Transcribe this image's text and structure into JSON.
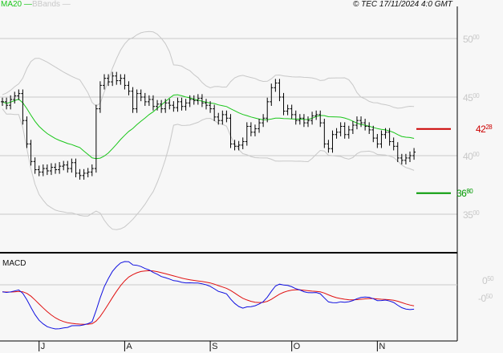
{
  "legend": {
    "ma_label": "MA20",
    "bb_label": "BBands",
    "copyright": "© TEC 17/11/2024 4:0 GMT"
  },
  "colors": {
    "ma": "#19c619",
    "bands": "#c8c8c8",
    "macd": "#1010e0",
    "signal": "#e01010",
    "resistance": "#cc0000",
    "support": "#009900"
  },
  "chart_data": {
    "type": "line",
    "title": "",
    "price_axis": {
      "ticks": [
        {
          "int": "50",
          "dec": "00",
          "value": 50
        },
        {
          "int": "45",
          "dec": "00",
          "value": 45
        },
        {
          "int": "40",
          "dec": "00",
          "value": 40
        },
        {
          "int": "35",
          "dec": "00",
          "value": 35
        }
      ],
      "ylim": [
        32.5,
        53.3
      ]
    },
    "levels": {
      "resistance": {
        "label_int": "42",
        "label_dec": "28",
        "value": 42.28
      },
      "support": {
        "label_int": "36",
        "label_dec": "80",
        "value": 36.8
      }
    },
    "macd_axis": {
      "title": "MACD",
      "ticks": [
        {
          "int": "0",
          "dec": "50",
          "value": 0.5
        },
        {
          "int": "-0",
          "dec": "50",
          "value": -0.5
        }
      ]
    },
    "months": [
      {
        "label": "J",
        "index": 9
      },
      {
        "label": "A",
        "index": 30
      },
      {
        "label": "S",
        "index": 51
      },
      {
        "label": "O",
        "index": 71
      },
      {
        "label": "N",
        "index": 92
      }
    ],
    "closes": [
      44.6,
      44.3,
      44.8,
      45.1,
      45.3,
      43.0,
      41.0,
      39.5,
      38.8,
      38.6,
      38.9,
      38.7,
      39.0,
      38.8,
      39.1,
      39.2,
      38.9,
      39.4,
      38.5,
      38.3,
      38.5,
      38.6,
      38.9,
      44.0,
      46.0,
      46.6,
      46.3,
      46.8,
      46.4,
      46.6,
      46.0,
      45.5,
      44.0,
      45.3,
      45.0,
      44.6,
      44.8,
      44.2,
      44.4,
      44.0,
      44.5,
      44.3,
      44.1,
      44.6,
      44.2,
      44.5,
      44.8,
      44.7,
      44.9,
      44.5,
      44.3,
      44.0,
      43.3,
      43.0,
      43.5,
      43.2,
      41.0,
      40.8,
      40.9,
      41.2,
      42.5,
      42.0,
      42.3,
      42.8,
      43.2,
      44.6,
      45.8,
      46.2,
      45.0,
      43.8,
      44.0,
      43.5,
      43.0,
      43.2,
      42.8,
      43.0,
      43.4,
      43.5,
      42.8,
      41.0,
      40.6,
      41.8,
      42.0,
      42.5,
      41.8,
      42.2,
      42.6,
      43.0,
      42.8,
      42.5,
      42.2,
      41.5,
      41.0,
      41.8,
      42.0,
      41.2,
      40.8,
      39.8,
      39.6,
      39.8,
      40.0,
      40.3
    ]
  }
}
